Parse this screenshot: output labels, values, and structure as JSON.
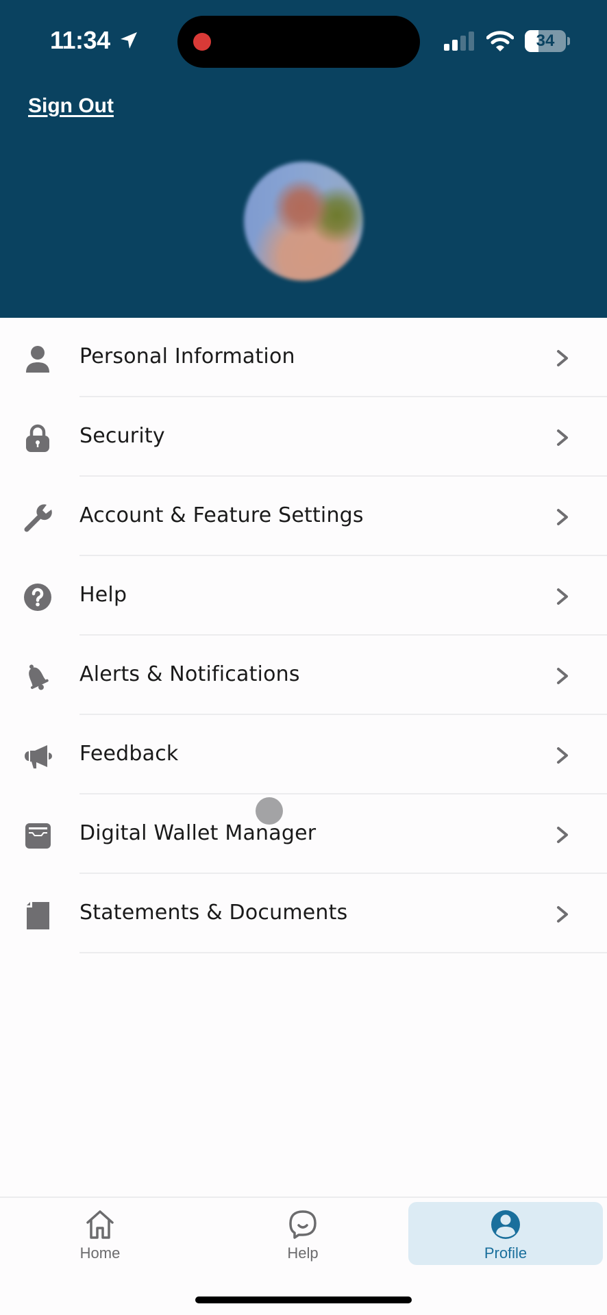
{
  "status_bar": {
    "time": "11:34",
    "battery_percent": 34,
    "battery_label": "34",
    "signal_bars_active": 2,
    "signal_bars_total": 4,
    "recording": true
  },
  "header": {
    "sign_out_label": "Sign Out",
    "background_color": "#0a4260"
  },
  "menu": {
    "items": [
      {
        "label": "Personal Information",
        "icon": "person-icon"
      },
      {
        "label": "Security",
        "icon": "lock-icon"
      },
      {
        "label": "Account & Feature Settings",
        "icon": "wrench-icon"
      },
      {
        "label": "Help",
        "icon": "question-circle-icon"
      },
      {
        "label": "Alerts & Notifications",
        "icon": "bell-icon"
      },
      {
        "label": "Feedback",
        "icon": "megaphone-icon"
      },
      {
        "label": "Digital Wallet Manager",
        "icon": "wallet-icon"
      },
      {
        "label": "Statements & Documents",
        "icon": "document-icon"
      }
    ]
  },
  "tabbar": {
    "tabs": [
      {
        "label": "Home",
        "icon": "home-icon",
        "active": false
      },
      {
        "label": "Help",
        "icon": "chat-bubble-icon",
        "active": false
      },
      {
        "label": "Profile",
        "icon": "profile-icon",
        "active": true
      }
    ],
    "active_color": "#1a6f9c",
    "active_background": "#dcebf4"
  }
}
